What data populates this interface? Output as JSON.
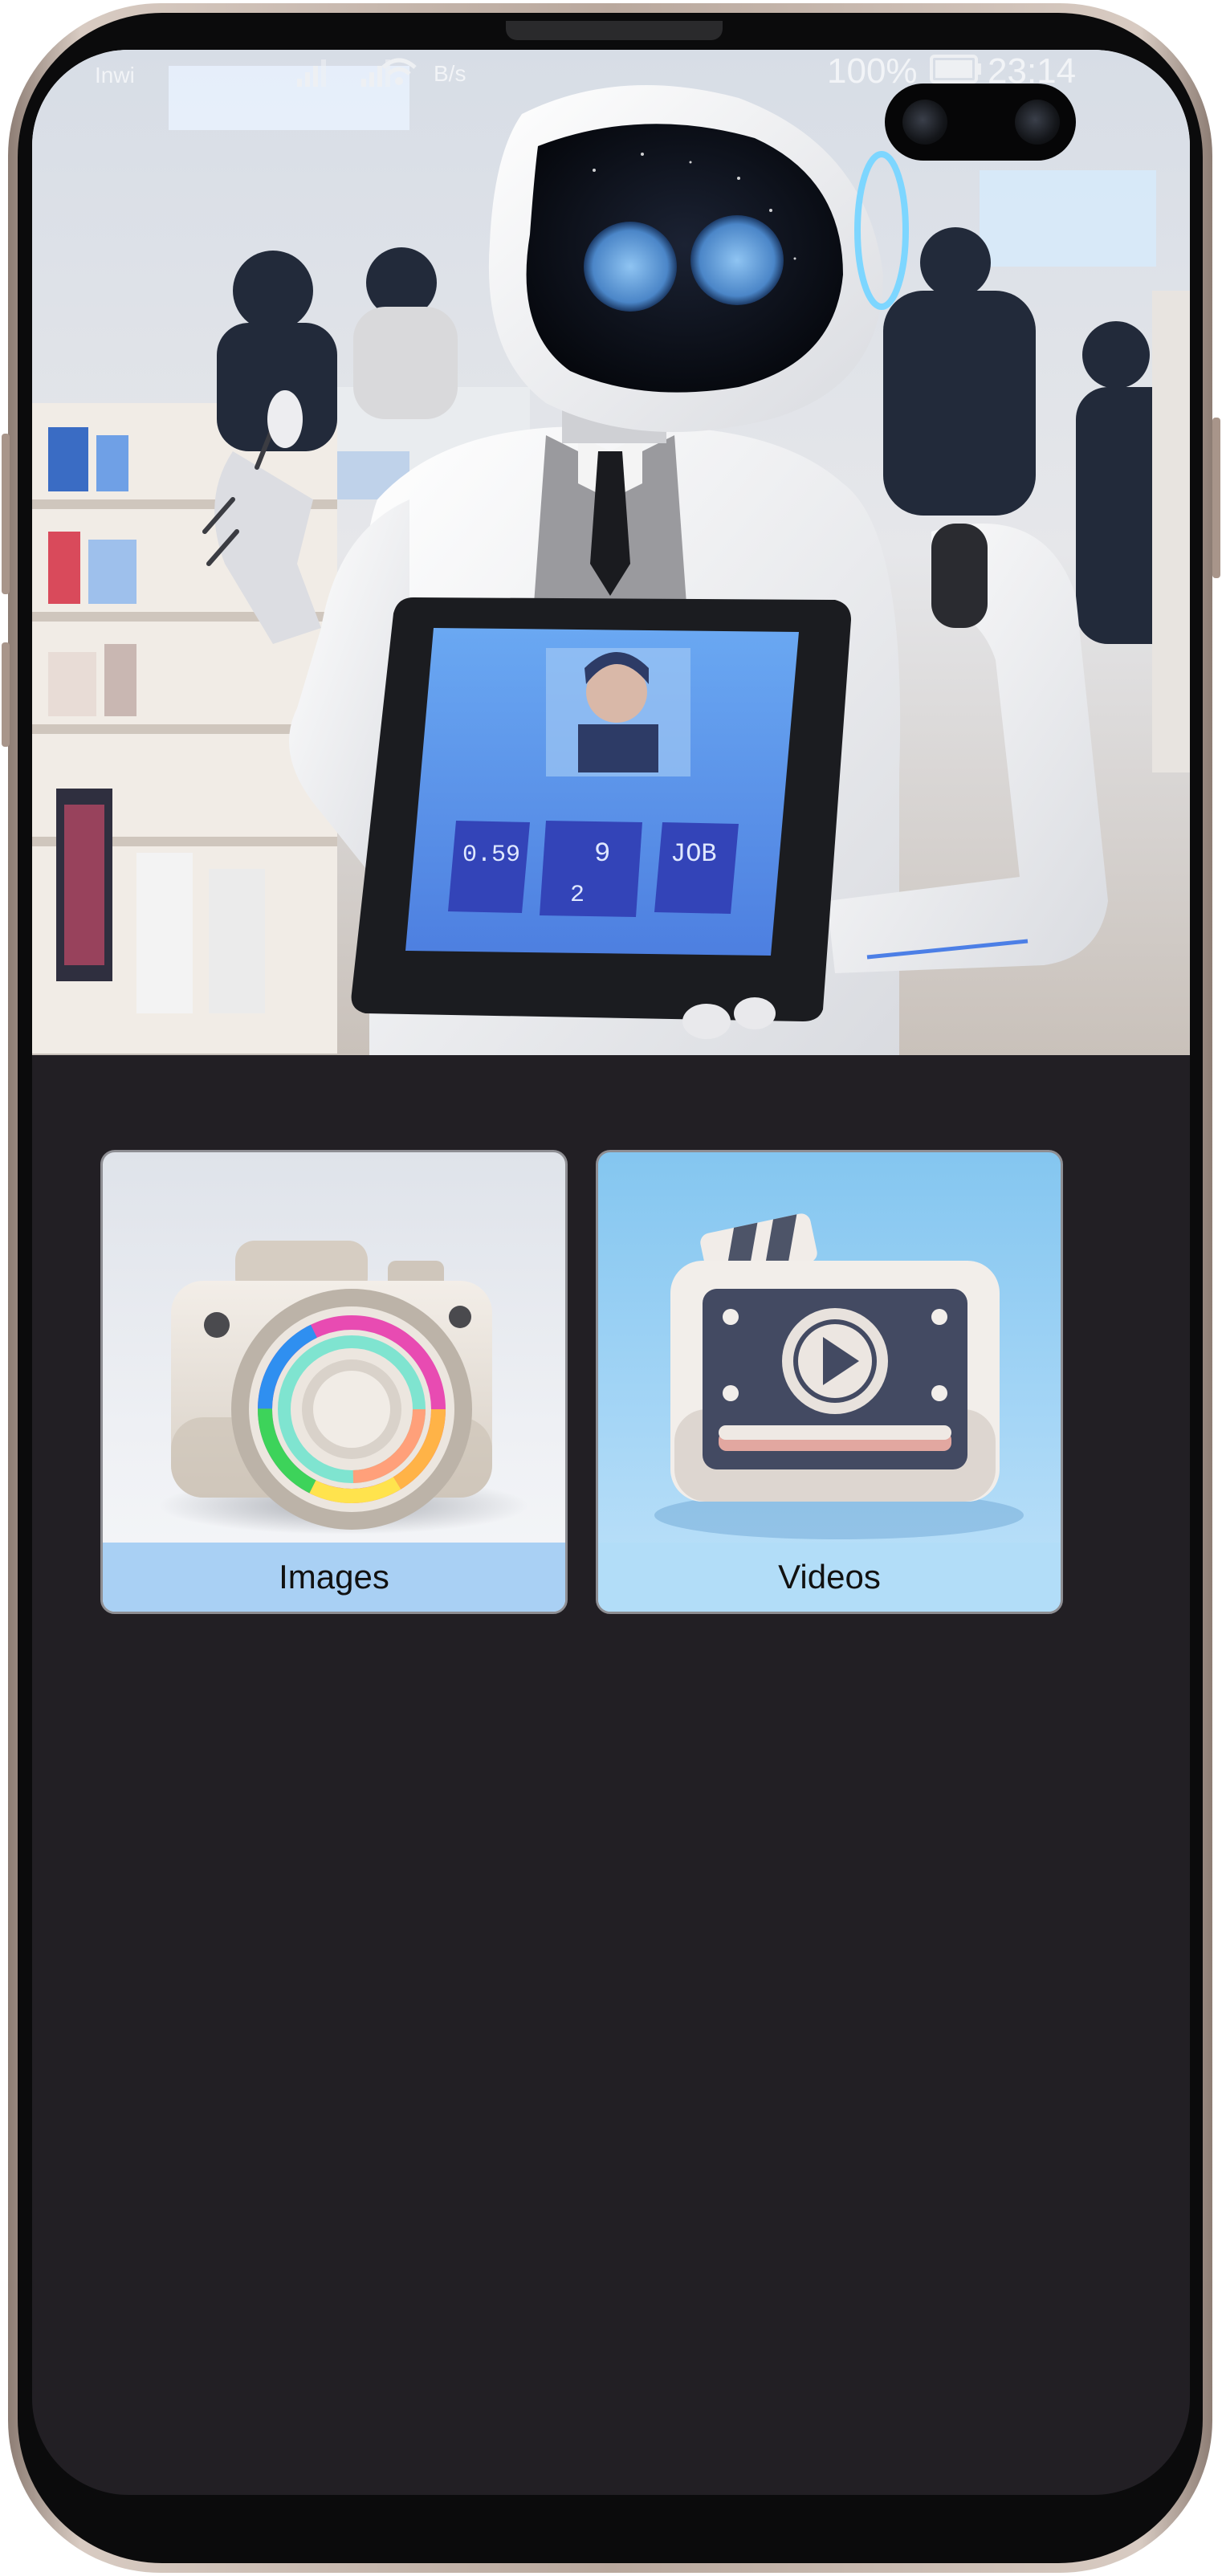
{
  "status_bar": {
    "carrier": "Inwi",
    "net_speed": "B/s",
    "battery": "100%",
    "time": "23:14"
  },
  "hero": {
    "tablet_cards": [
      "0.59",
      "9",
      "2",
      "JOB"
    ]
  },
  "tiles": [
    {
      "label": "Images",
      "icon": "camera-icon"
    },
    {
      "label": "Videos",
      "icon": "video-player-icon"
    }
  ],
  "colors": {
    "screen_background": "#221f24",
    "tile_label_background": "#a9d0f4",
    "tablet_screen": "#5b8fe8"
  }
}
